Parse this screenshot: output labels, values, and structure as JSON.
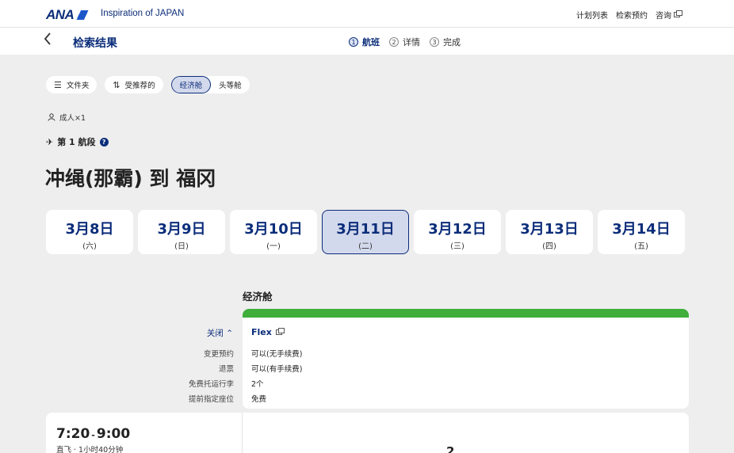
{
  "brand": {
    "logo_text": "ANA",
    "tagline": "Inspiration of JAPAN"
  },
  "top_links": {
    "plan_list": "计划列表",
    "search_booking": "检索预约",
    "inquiry": "咨询"
  },
  "header": {
    "back_icon": "chevron-left-icon",
    "title": "检索结果"
  },
  "steps": [
    {
      "num": "1",
      "label": "航班"
    },
    {
      "num": "2",
      "label": "详情"
    },
    {
      "num": "3",
      "label": "完成"
    }
  ],
  "toolbar": {
    "folder_label": "文件夹",
    "sort_label": "受推荐的",
    "economy_label": "经济舱",
    "first_label": "头等舱"
  },
  "passengers": "成人×1",
  "segment_label": "第 1 航段",
  "route": "冲绳(那霸) 到 福冈",
  "dates": [
    {
      "date": "3月8日",
      "weekday": "(六)"
    },
    {
      "date": "3月9日",
      "weekday": "(日)"
    },
    {
      "date": "3月10日",
      "weekday": "(一)"
    },
    {
      "date": "3月11日",
      "weekday": "(二)"
    },
    {
      "date": "3月12日",
      "weekday": "(三)"
    },
    {
      "date": "3月13日",
      "weekday": "(四)"
    },
    {
      "date": "3月14日",
      "weekday": "(五)"
    }
  ],
  "cabin_heading": "经济舱",
  "fare": {
    "name": "Flex",
    "collapse_label": "关闭",
    "rows": [
      {
        "label": "变更预约",
        "value": "可以(无手续费)"
      },
      {
        "label": "退票",
        "value": "可以(有手续费)"
      },
      {
        "label": "免费托运行李",
        "value": "2个"
      },
      {
        "label": "提前指定座位",
        "value": "免费"
      }
    ],
    "stripe_color": "#3fae3a"
  },
  "flight": {
    "depart": "7:20",
    "arrive": "9:00",
    "info": "直飞 · 1小时40分钟",
    "seats": "2"
  },
  "colors": {
    "brand_navy": "#0b2d7a",
    "selected_bg": "#d3d9ec",
    "page_bg": "#eeeeee"
  }
}
